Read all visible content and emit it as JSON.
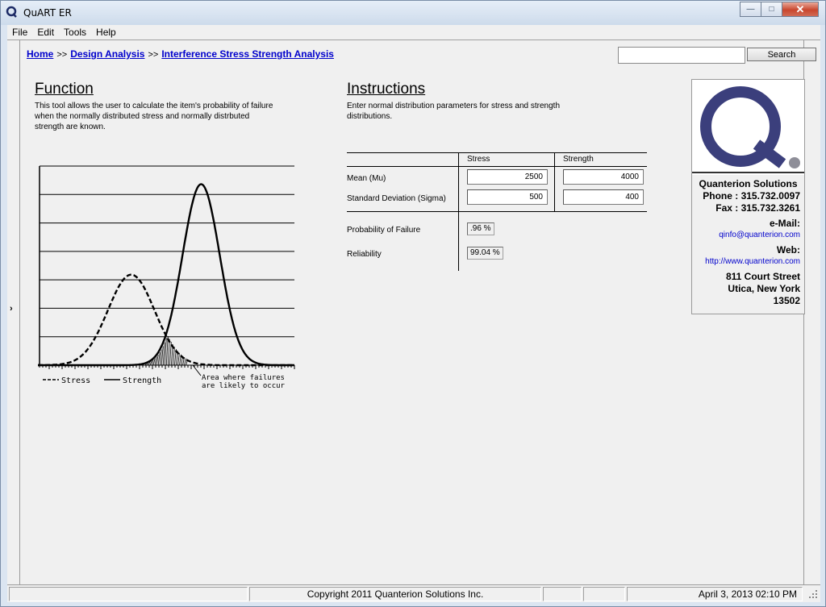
{
  "window": {
    "title": "QuART ER",
    "minimize_glyph": "—",
    "maximize_glyph": "□",
    "close_glyph": "✕"
  },
  "menu": [
    "File",
    "Edit",
    "Tools",
    "Help"
  ],
  "breadcrumb": {
    "home": "Home",
    "sep": ">>",
    "design": "Design Analysis",
    "current": "Interference Stress Strength Analysis"
  },
  "search": {
    "value": "",
    "button": "Search"
  },
  "function": {
    "title": "Function",
    "description": "This tool allows the user to calculate the item's probability of failure when the normally distributed stress and normally distrbuted strength are known."
  },
  "instructions": {
    "title": "Instructions",
    "description": "Enter normal distribution parameters for stress and strength distributions."
  },
  "chart_data": {
    "type": "line",
    "title": "",
    "series": [
      {
        "name": "Stress",
        "style": "dashed",
        "mean": 2500,
        "sigma": 500,
        "peak_frac": 0.5
      },
      {
        "name": "Strength",
        "style": "solid",
        "mean": 4000,
        "sigma": 400,
        "peak_frac": 1.0
      }
    ],
    "xlim": [
      500,
      6000
    ],
    "ylim": [
      0,
      1.1
    ],
    "gridlines": 7,
    "legend": {
      "stress": "Stress",
      "strength": "Strength",
      "annotation_line1": "Area where failures",
      "annotation_line2": "are likely to occur"
    }
  },
  "form": {
    "col_stress": "Stress",
    "col_strength": "Strength",
    "mean_label": "Mean (Mu)",
    "sigma_label": "Standard Deviation (Sigma)",
    "stress_mean": "2500",
    "strength_mean": "4000",
    "stress_sigma": "500",
    "strength_sigma": "400",
    "pof_label": "Probability of Failure",
    "pof_value": ".96 %",
    "rel_label": "Reliability",
    "rel_value": "99.04 %"
  },
  "contact": {
    "company": "Quanterion Solutions",
    "phone": "Phone : 315.732.0097",
    "fax": "Fax : 315.732.3261",
    "email_label": "e-Mail:",
    "email": "qinfo@quanterion.com",
    "web_label": "Web:",
    "web": "http://www.quanterion.com",
    "street": "811 Court Street",
    "city": "Utica, New York",
    "zip": "13502",
    "logo_letter": "Q"
  },
  "status": {
    "copyright": "Copyright 2011 Quanterion Solutions Inc.",
    "datetime": "April 3, 2013  02:10 PM"
  },
  "colors": {
    "logo_navy": "#3b3f7c",
    "logo_dot": "#8e8e98",
    "link": "#0000cc"
  }
}
